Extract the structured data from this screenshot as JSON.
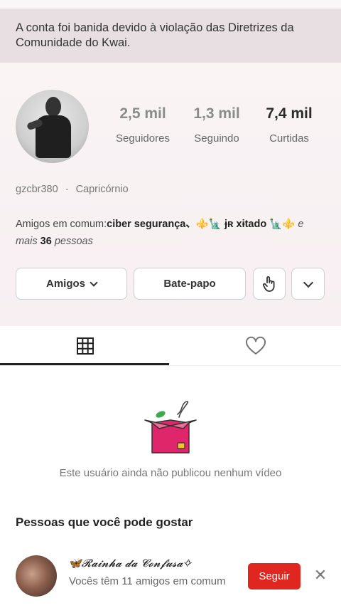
{
  "banner": {
    "text": "A conta foi banida devido à violação das Diretrizes da Comunidade do Kwai."
  },
  "stats": [
    {
      "value": "2,5 mil",
      "label": "Seguidores"
    },
    {
      "value": "1,3 mil",
      "label": "Seguindo"
    },
    {
      "value": "7,4 mil",
      "label": "Curtidas"
    }
  ],
  "profile": {
    "username": "gzcbr380",
    "sign": "Capricórnio",
    "separator": "·"
  },
  "mutual": {
    "prefix": "Amigos em comum:",
    "names": "ciber segurança、⚜️🗽 ɉʀ xɨtado 🗽⚜️",
    "suffix_pre": " e mais ",
    "count": "36",
    "suffix_post": " pessoas"
  },
  "actions": {
    "friends_label": "Amigos",
    "chat_label": "Bate-papo",
    "hand_icon": "hand-tap-icon",
    "more_icon": "chevron-down-icon"
  },
  "tabs": [
    {
      "icon": "grid-icon",
      "active": true
    },
    {
      "icon": "heart-icon",
      "active": false
    }
  ],
  "empty_state": {
    "text": "Este usuário ainda não publicou nenhum vídeo"
  },
  "suggestions": {
    "title": "Pessoas que você pode gostar",
    "items": [
      {
        "name": "🦋𝓡𝓪𝓲𝓷𝓱𝓪 𝓭𝓪 𝓒𝓸𝓷𝓯𝓾𝓼𝓪✧",
        "desc": "Vocês têm 11 amigos em comum",
        "follow_label": "Seguir",
        "close": "✕"
      }
    ]
  },
  "colors": {
    "accent": "#e0261e",
    "banner_bg": "#e7dfe1",
    "box_pink": "#e0266a"
  }
}
